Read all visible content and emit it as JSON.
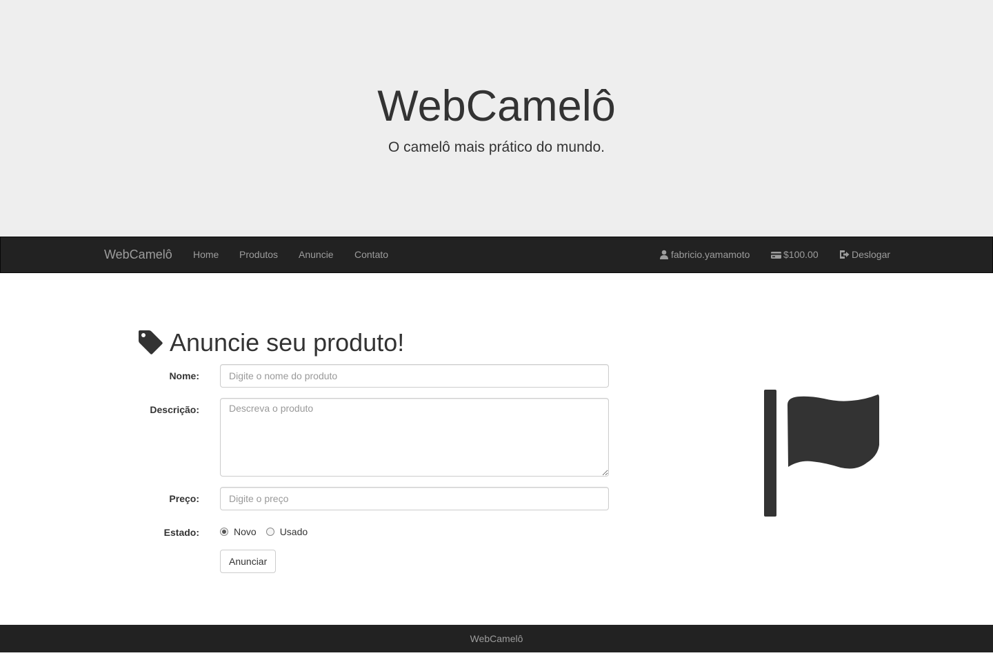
{
  "hero": {
    "title": "WebCamelô",
    "subtitle": "O camelô mais prático do mundo."
  },
  "navbar": {
    "brand": "WebCamelô",
    "links": [
      {
        "label": "Home"
      },
      {
        "label": "Produtos"
      },
      {
        "label": "Anuncie"
      },
      {
        "label": "Contato"
      }
    ],
    "user": {
      "label": "fabricio.yamamoto",
      "icon": "user-icon"
    },
    "balance": {
      "label": "$100.00",
      "icon": "credit-card-icon"
    },
    "logout": {
      "label": "Deslogar",
      "icon": "log-out-icon"
    }
  },
  "form": {
    "heading": "Anuncie seu produto!",
    "heading_icon": "tag-icon",
    "name": {
      "label": "Nome:",
      "placeholder": "Digite o nome do produto",
      "value": ""
    },
    "description": {
      "label": "Descrição:",
      "placeholder": "Descreva o produto",
      "value": ""
    },
    "price": {
      "label": "Preço:",
      "placeholder": "Digite o preço",
      "value": ""
    },
    "state": {
      "label": "Estado:",
      "options": [
        {
          "label": "Novo",
          "checked": true
        },
        {
          "label": "Usado",
          "checked": false
        }
      ]
    },
    "submit_label": "Anunciar"
  },
  "side_icon": "flag-icon",
  "footer": {
    "text": "WebCamelô"
  },
  "colors": {
    "hero_bg": "#eeeeee",
    "navbar_bg": "#222222",
    "nav_text": "#9d9d9d",
    "icon_dark": "#333333"
  }
}
